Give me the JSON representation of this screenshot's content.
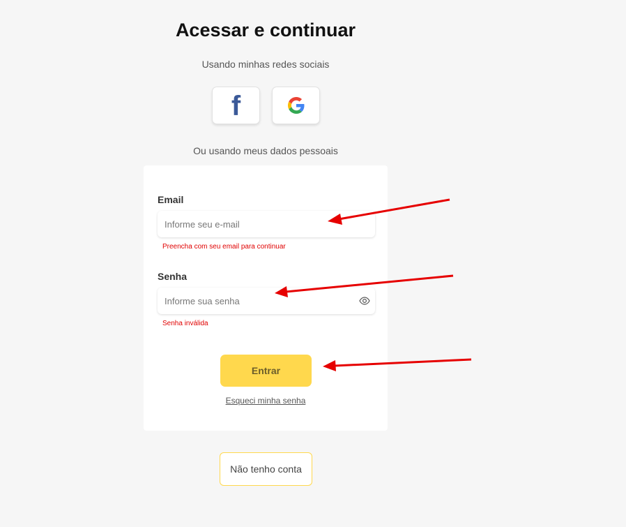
{
  "header": {
    "title": "Acessar e continuar",
    "social_subtitle": "Usando minhas redes sociais",
    "personal_subtitle": "Ou usando meus dados pessoais"
  },
  "social": {
    "facebook_glyph": "f",
    "facebook_icon": "facebook-icon",
    "google_icon": "google-icon",
    "google_colors": [
      "#4285F4",
      "#34A853",
      "#FBBC05",
      "#EA4335"
    ]
  },
  "form": {
    "email_label": "Email",
    "email_placeholder": "Informe seu e-mail",
    "email_value": "",
    "email_error": "Preencha com seu email para continuar",
    "password_label": "Senha",
    "password_placeholder": "Informe sua senha",
    "password_value": "",
    "password_error": "Senha inválida",
    "submit_label": "Entrar",
    "forgot_label": "Esqueci minha senha"
  },
  "footer": {
    "no_account_label": "Não tenho conta"
  },
  "colors": {
    "background": "#f6f6f6",
    "accent": "#ffd84d",
    "error": "#e00000",
    "facebook": "#3b5998",
    "annotation_arrow": "#e60000"
  }
}
